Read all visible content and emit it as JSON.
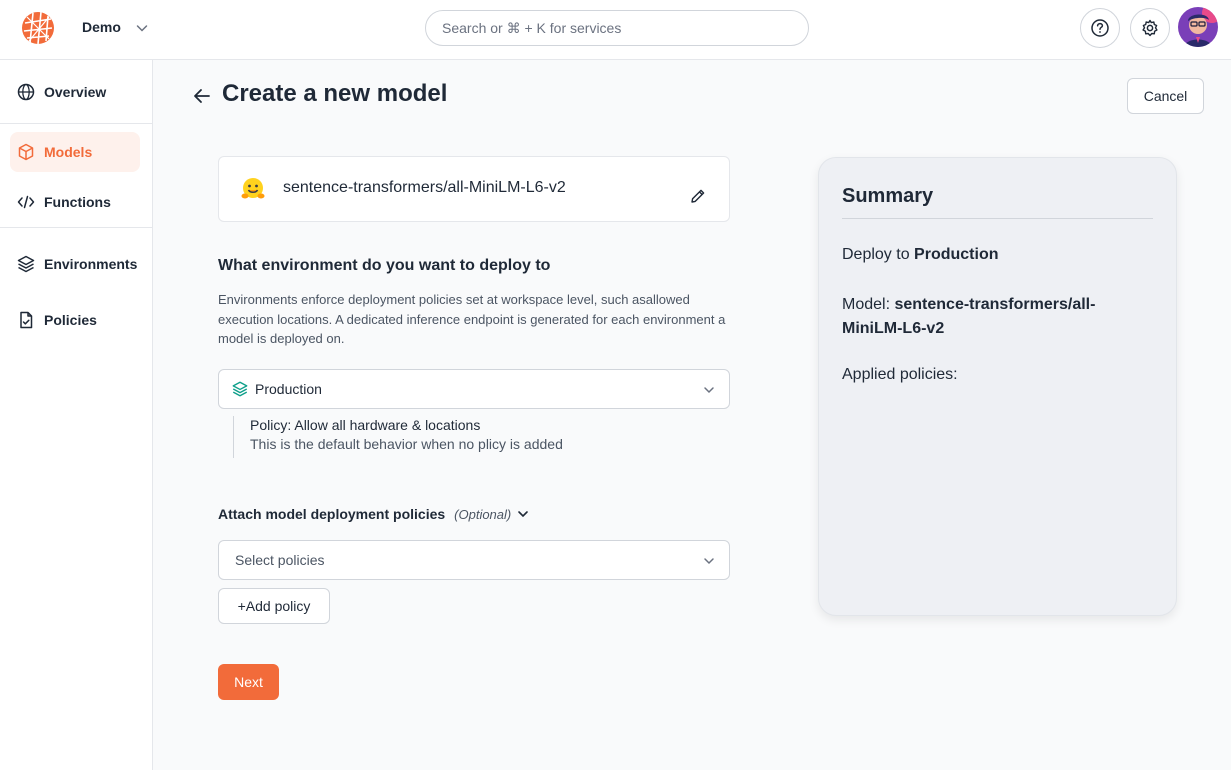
{
  "header": {
    "workspace": "Demo",
    "search_placeholder": "Search or ⌘ + K for services"
  },
  "sidebar": {
    "items": [
      {
        "label": "Overview",
        "icon": "globe-icon"
      },
      {
        "label": "Models",
        "icon": "cube-icon",
        "active": true
      },
      {
        "label": "Functions",
        "icon": "code-icon"
      },
      {
        "label": "Environments",
        "icon": "layers-icon"
      },
      {
        "label": "Policies",
        "icon": "document-icon"
      }
    ]
  },
  "main": {
    "title": "Create a new model",
    "cancel_label": "Cancel",
    "model_name": "sentence-transformers/all-MiniLM-L6-v2",
    "env_section_title": "What environment do you want to deploy to",
    "env_section_desc": "Environments enforce deployment policies set at workspace level, such asallowed execution locations. A dedicated inference endpoint is generated for each environment a model is deployed on.",
    "env_selected": "Production",
    "policy_title": "Policy: Allow all hardware & locations",
    "policy_desc": "This is the default behavior when no plicy is added",
    "attach_label": "Attach model deployment policies",
    "attach_optional": "(Optional)",
    "policies_placeholder": "Select policies",
    "add_policy_label": "+Add policy",
    "next_label": "Next"
  },
  "summary": {
    "title": "Summary",
    "deploy_prefix": "Deploy to ",
    "deploy_env": "Production",
    "model_prefix": "Model: ",
    "model_value": "sentence-transformers/all-MiniLM-L6-v2",
    "applied_policies": "Applied policies:"
  },
  "colors": {
    "accent": "#f26b3a",
    "active_bg": "#fef1ec",
    "summary_bg": "#eef0f4"
  }
}
